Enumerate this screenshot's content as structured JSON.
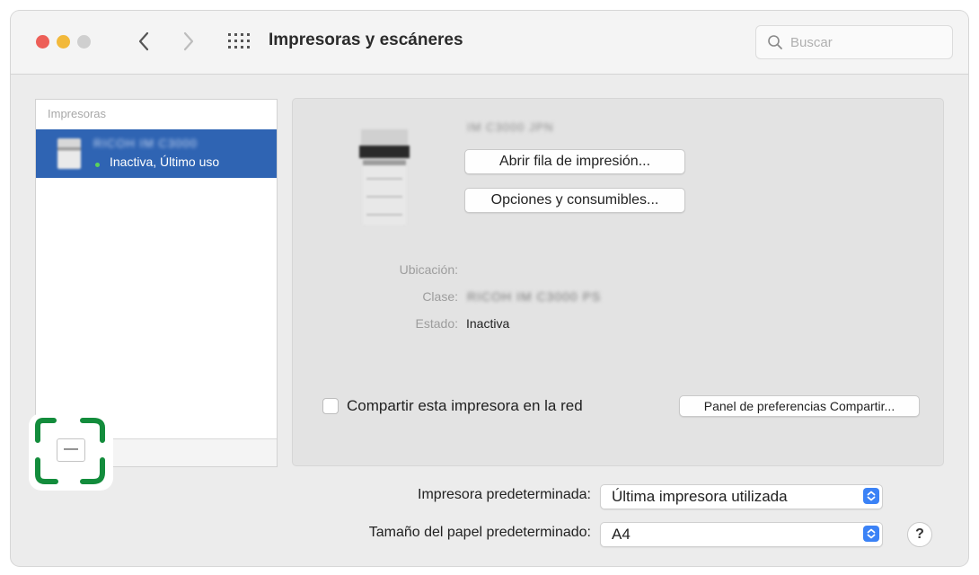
{
  "window": {
    "title": "Impresoras y escáneres",
    "search": {
      "placeholder": "Buscar",
      "value": ""
    }
  },
  "sidebar": {
    "header": "Impresoras",
    "printers": [
      {
        "name": "RICOH IM C3000",
        "status": "Inactiva, Último uso",
        "selected": true
      }
    ],
    "remove_label": "—"
  },
  "detail": {
    "printer_name": "IM C3000 JPN",
    "buttons": {
      "open_queue": "Abrir fila de impresión...",
      "options": "Opciones y consumibles..."
    },
    "fields": {
      "location_label": "Ubicación:",
      "location_value": "",
      "class_label": "Clase:",
      "class_value": "RICOH IM C3000 PS",
      "state_label": "Estado:",
      "state_value": "Inactiva"
    },
    "share": {
      "label": "Compartir esta impresora en la red",
      "checked": false,
      "prefs_button": "Panel de preferencias Compartir..."
    }
  },
  "bottom": {
    "default_printer_label": "Impresora predeterminada:",
    "default_printer_value": "Última impresora utilizada",
    "paper_size_label": "Tamaño del papel predeterminado:",
    "paper_size_value": "A4",
    "help_label": "?"
  },
  "colors": {
    "selection": "#2f64b3",
    "highlight": "#138c3c",
    "accent": "#3b82f6"
  }
}
